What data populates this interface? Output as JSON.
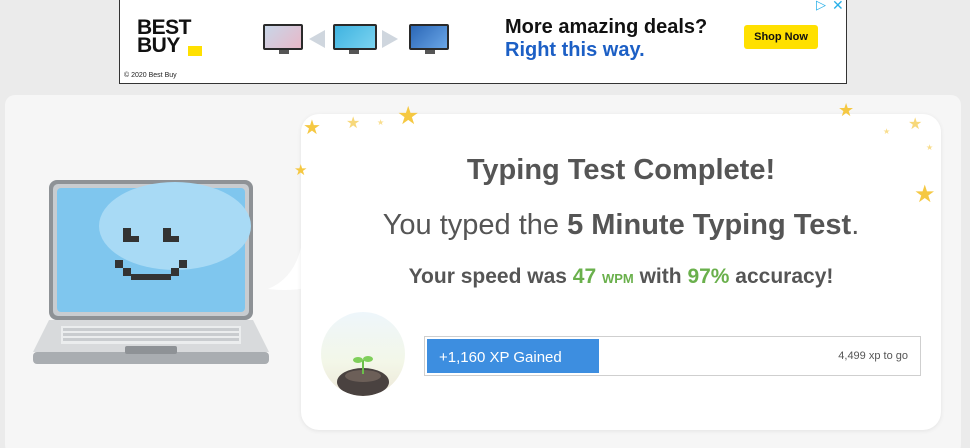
{
  "ad": {
    "logo_line1": "BEST",
    "logo_line2": "BUY",
    "copyright": "© 2020 Best Buy",
    "headline_line1": "More amazing deals?",
    "headline_line2": "Right this way.",
    "cta": "Shop Now",
    "adchoices_glyph": "▷",
    "close_glyph": "✕",
    "brand_color": "#ffe000",
    "accent_color": "#1c5fc5"
  },
  "result": {
    "title": "Typing Test Complete!",
    "subtitle_prefix": "You typed the ",
    "test_name": "5 Minute Typing Test",
    "subtitle_suffix": ".",
    "speed_prefix": "Your speed was ",
    "wpm_value": "47",
    "wpm_unit": "WPM",
    "speed_mid": " with ",
    "accuracy": "97%",
    "speed_suffix": " accuracy!"
  },
  "xp": {
    "gained_label": "+1,160 XP Gained",
    "to_go_label": "4,499 xp to go",
    "progress_fraction": 0.35,
    "fill_color": "#3d8ee0"
  },
  "icons": {
    "mascot": "smiling-laptop-icon",
    "avatar": "sprout-avatar-icon",
    "decoration": "star-icon"
  }
}
